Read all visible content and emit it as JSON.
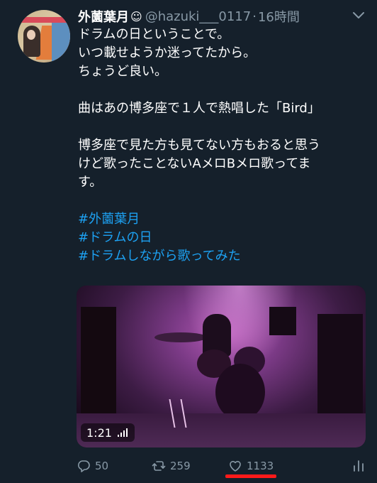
{
  "tweet": {
    "display_name": "外薗葉月",
    "emoji": "☺",
    "handle": "@hazuki___0117",
    "separator": "·",
    "time": "16時間",
    "lines": [
      "ドラムの日ということで。",
      "いつ載せようか迷ってたから。",
      "ちょうど良い。",
      "曲はあの博多座で１人で熱唱した「Bird」",
      "博多座で見た方も見てない方もおると思う",
      "けど歌ったことないAメロBメロ歌ってま",
      "す。"
    ],
    "hashtags": [
      "#外薗葉月",
      "#ドラムの日",
      "#ドラムしながら歌ってみた"
    ],
    "video": {
      "duration": "1:21"
    },
    "actions": {
      "reply_count": "50",
      "retweet_count": "259",
      "like_count": "1133"
    }
  },
  "colors": {
    "background": "#15202b",
    "hashtag": "#1da1f2",
    "muted": "#8899a6",
    "highlight_underline": "#ff1a1a"
  },
  "icons": {
    "more": "chevron-down-icon",
    "reply": "reply-icon",
    "retweet": "retweet-icon",
    "like": "heart-icon",
    "stats": "analytics-icon",
    "volume": "audio-bars-icon"
  }
}
